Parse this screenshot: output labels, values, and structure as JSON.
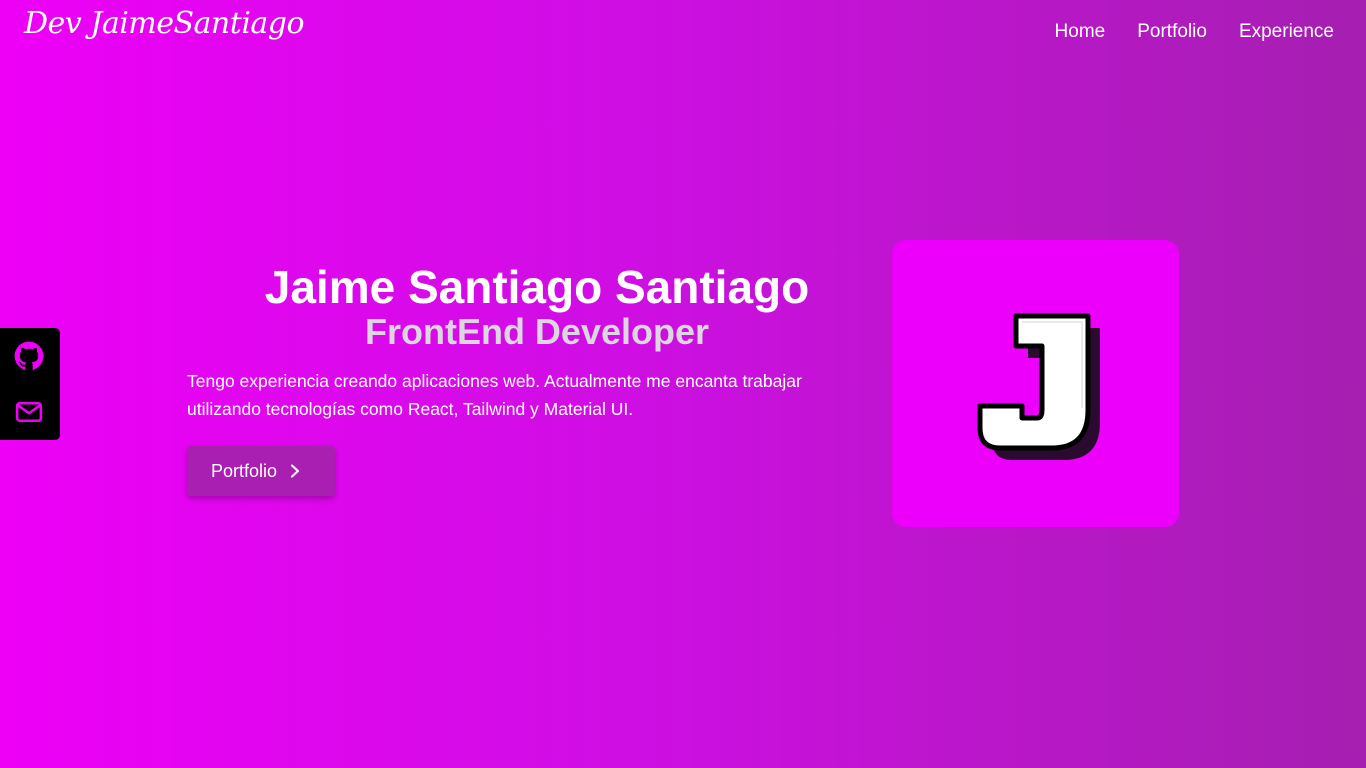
{
  "header": {
    "logo_text": "Dev JaimeSantiago",
    "nav": [
      {
        "label": "Home"
      },
      {
        "label": "Portfolio"
      },
      {
        "label": "Experience"
      }
    ]
  },
  "social": {
    "items": [
      {
        "icon": "github-icon"
      },
      {
        "icon": "mail-icon"
      }
    ]
  },
  "hero": {
    "name": "Jaime Santiago Santiago",
    "role": "FrontEnd Developer",
    "description": "Tengo experiencia creando aplicaciones web. Actualmente me encanta trabajar utilizando tecnologías como React, Tailwind y Material UI.",
    "cta_label": "Portfolio",
    "cta_icon": "chevron-right-icon",
    "avatar_letter": "J"
  },
  "colors": {
    "gradient_start": "#ee00f7",
    "gradient_end": "#a51fb0",
    "card_bg": "#ed00fb",
    "button_bg": "#a81fb1",
    "subtitle": "#dcd6e0",
    "social_bg": "#000000",
    "social_icon": "#ee00f7"
  }
}
